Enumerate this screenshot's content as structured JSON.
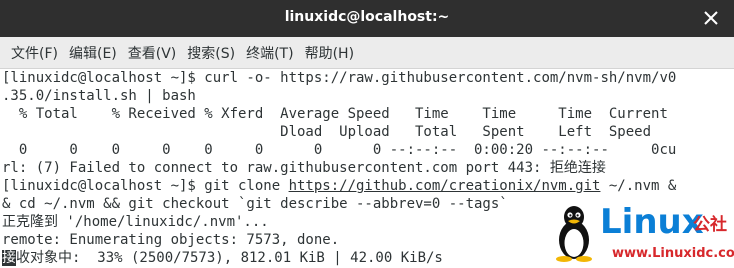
{
  "window": {
    "title": "linuxidc@localhost:~"
  },
  "menu": {
    "items": [
      {
        "label": "文件(F)"
      },
      {
        "label": "编辑(E)"
      },
      {
        "label": "查看(V)"
      },
      {
        "label": "搜索(S)"
      },
      {
        "label": "终端(T)"
      },
      {
        "label": "帮助(H)"
      }
    ]
  },
  "terminal": {
    "lines": [
      {
        "text": "[linuxidc@localhost ~]$ curl -o- https://raw.githubusercontent.com/nvm-sh/nvm/v0"
      },
      {
        "text": ".35.0/install.sh | bash"
      },
      {
        "text": "  % Total    % Received % Xferd  Average Speed   Time    Time     Time  Current"
      },
      {
        "text": "                                 Dload  Upload   Total   Spent    Left  Speed"
      },
      {
        "text": "  0     0    0     0    0     0      0      0 --:--:--  0:00:20 --:--:--     0cu"
      },
      {
        "text": "rl: (7) Failed to connect to raw.githubusercontent.com port 443: 拒绝连接"
      },
      {
        "prefix": "[linuxidc@localhost ~]$ git clone ",
        "link": "https://github.com/creationix/nvm.git",
        "suffix": " ~/.nvm &"
      },
      {
        "text": "& cd ~/.nvm && git checkout `git describe --abbrev=0 --tags`"
      },
      {
        "text": "正克隆到 '/home/linuxidc/.nvm'..."
      },
      {
        "text": "remote: Enumerating objects: 7573, done."
      },
      {
        "cursor": "接",
        "rest": "收对象中:  33% (2500/7573), 812.01 KiB | 42.00 KiB/s"
      }
    ]
  },
  "watermark": {
    "brand": "Linux",
    "brand_cn": "公社",
    "site": "www.Linuxidc.com",
    "icon": "tux-penguin-icon",
    "colors": {
      "brand": "#0b7fd6",
      "accent": "#d7282c"
    }
  }
}
